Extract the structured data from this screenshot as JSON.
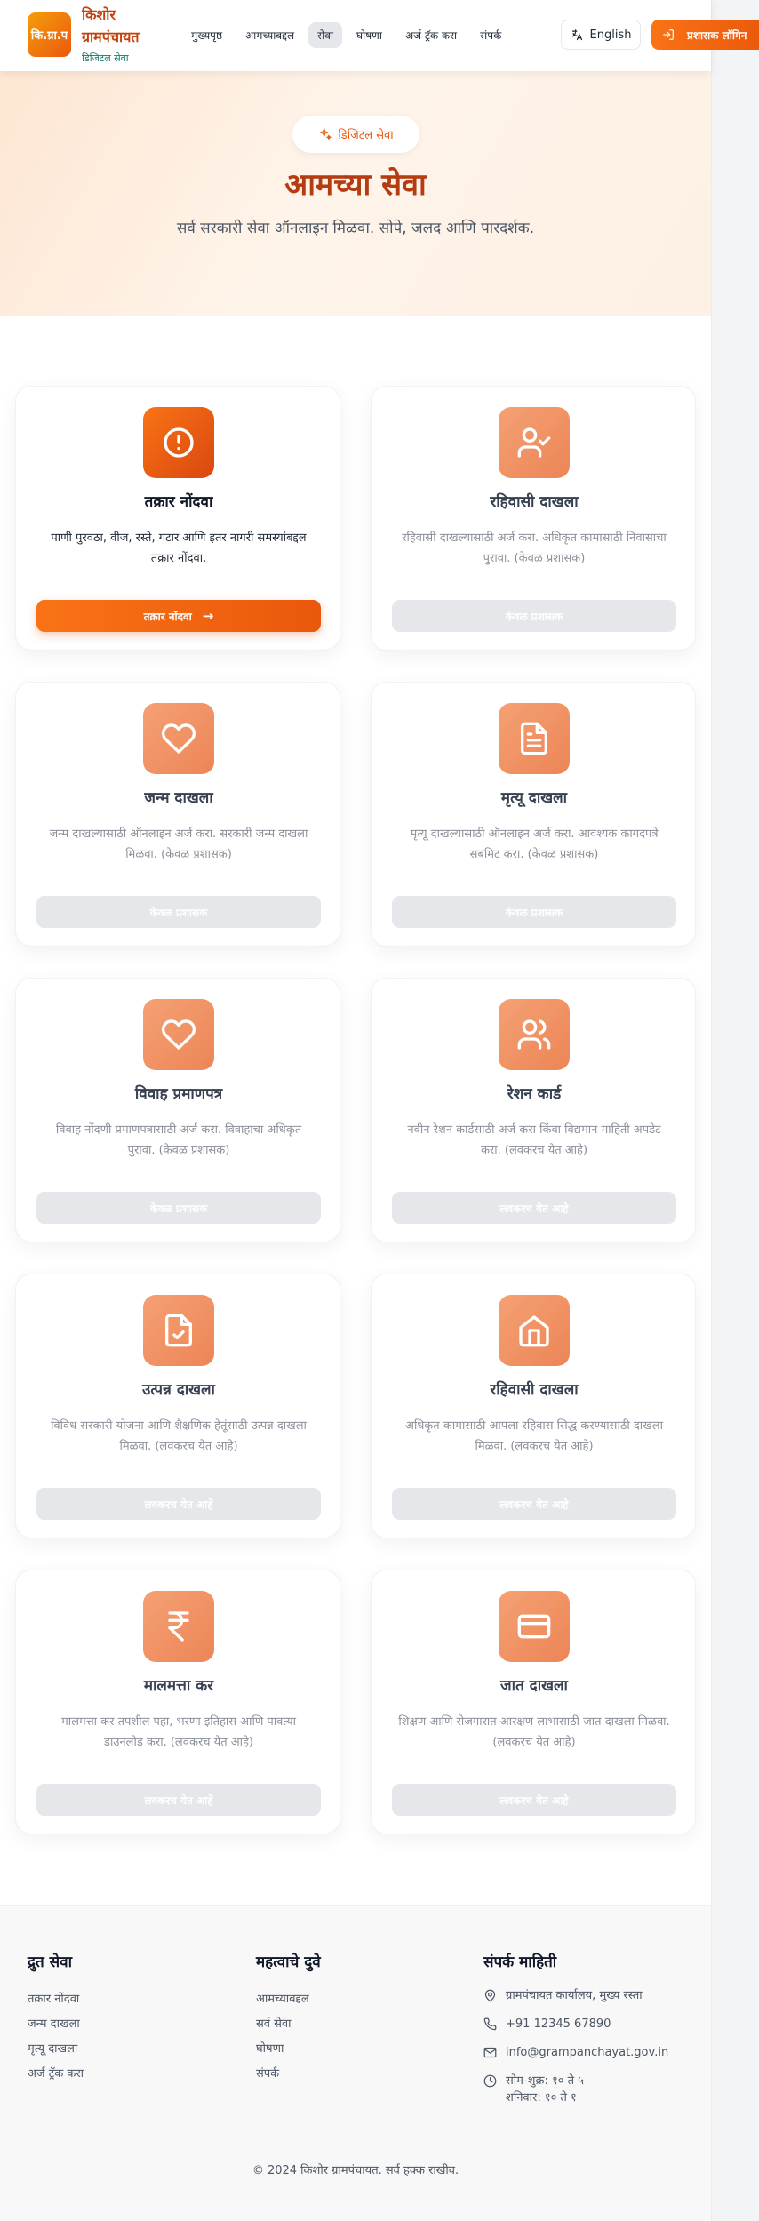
{
  "header": {
    "logo_text": "कि.ग्रा.प",
    "title": "किशोर ग्रामपंचायत",
    "subtitle": "डिजिटल सेवा",
    "nav": [
      {
        "label": "मुख्यपृष्ठ"
      },
      {
        "label": "आमच्याबद्दल"
      },
      {
        "label": "सेवा"
      },
      {
        "label": "घोषणा"
      },
      {
        "label": "अर्ज ट्रॅक करा"
      },
      {
        "label": "संपर्क"
      }
    ],
    "language_label": "English",
    "login_label": "प्रशासक लॉगिन"
  },
  "hero": {
    "badge": "डिजिटल सेवा",
    "title": "आमच्या सेवा",
    "subtitle": "सर्व सरकारी सेवा ऑनलाइन मिळवा. सोपे, जलद आणि पारदर्शक."
  },
  "services": [
    {
      "title": "तक्रार नोंदवा",
      "icon": "alert-circle-icon",
      "desc": "पाणी पुरवठा, वीज, रस्ते, गटार आणि इतर नागरी समस्यांबद्दल तक्रार नोंदवा.",
      "button": "तक्रार नोंदवा",
      "arrow": "→"
    },
    {
      "title": "रहिवासी दाखला",
      "icon": "user-check-icon",
      "desc": "रहिवासी दाखल्यासाठी अर्ज करा. अधिकृत कामासाठी निवासाचा पुरावा. (केवळ प्रशासक)",
      "button": "केवळ प्रशासक"
    },
    {
      "title": "जन्म दाखला",
      "icon": "heart-icon",
      "desc": "जन्म दाखल्यासाठी ऑनलाइन अर्ज करा. सरकारी जन्म दाखला मिळवा. (केवळ प्रशासक)",
      "button": "केवळ प्रशासक"
    },
    {
      "title": "मृत्यू दाखला",
      "icon": "document-icon",
      "desc": "मृत्यू दाखल्यासाठी ऑनलाइन अर्ज करा. आवश्यक कागदपत्रे सबमिट करा. (केवळ प्रशासक)",
      "button": "केवळ प्रशासक"
    },
    {
      "title": "विवाह प्रमाणपत्र",
      "icon": "heart-icon",
      "desc": "विवाह नोंदणी प्रमाणपत्रासाठी अर्ज करा. विवाहाचा अधिकृत पुरावा. (केवळ प्रशासक)",
      "button": "केवळ प्रशासक"
    },
    {
      "title": "रेशन कार्ड",
      "icon": "users-icon",
      "desc": "नवीन रेशन कार्डसाठी अर्ज करा किंवा विद्यमान माहिती अपडेट करा. (लवकरच येत आहे)",
      "button": "लवकरच येत आहे"
    },
    {
      "title": "उत्पन्न दाखला",
      "icon": "file-check-icon",
      "desc": "विविध सरकारी योजना आणि शैक्षणिक हेतूंसाठी उत्पन्न दाखला मिळवा. (लवकरच येत आहे)",
      "button": "लवकरच येत आहे"
    },
    {
      "title": "रहिवासी दाखला",
      "icon": "home-icon",
      "desc": "अधिकृत कामासाठी आपला रहिवास सिद्ध करण्यासाठी दाखला मिळवा. (लवकरच येत आहे)",
      "button": "लवकरच येत आहे"
    },
    {
      "title": "मालमत्ता कर",
      "icon": "rupee-icon",
      "desc": "मालमत्ता कर तपशील पहा, भरणा इतिहास आणि पावत्या डाउनलोड करा. (लवकरच येत आहे)",
      "button": "लवकरच येत आहे"
    },
    {
      "title": "जात दाखला",
      "icon": "card-icon",
      "desc": "शिक्षण आणि रोजगारात आरक्षण लाभासाठी जात दाखला मिळवा. (लवकरच येत आहे)",
      "button": "लवकरच येत आहे"
    }
  ],
  "footer": {
    "quick_title": "द्रुत सेवा",
    "quick_links": [
      "तक्रार नोंदवा",
      "जन्म दाखला",
      "मृत्यू दाखला",
      "अर्ज ट्रॅक करा"
    ],
    "important_title": "महत्वाचे दुवे",
    "important_links": [
      "आमच्याबद्दल",
      "सर्व सेवा",
      "घोषणा",
      "संपर्क"
    ],
    "contact_title": "संपर्क माहिती",
    "address": "ग्रामपंचायत कार्यालय, मुख्य रस्ता",
    "phone": "+91 12345 67890",
    "email": "info@grampanchayat.gov.in",
    "hours_line1": "सोम-शुक्र: १० ते ५",
    "hours_line2": "शनिवार: १० ते १",
    "copyright": "© 2024 किशोर ग्रामपंचायत. सर्व हक्क राखीव."
  },
  "colors": {
    "primary": "#ea580c",
    "hero_title": "#b43c10",
    "logo_subtitle": "#0f766e"
  }
}
